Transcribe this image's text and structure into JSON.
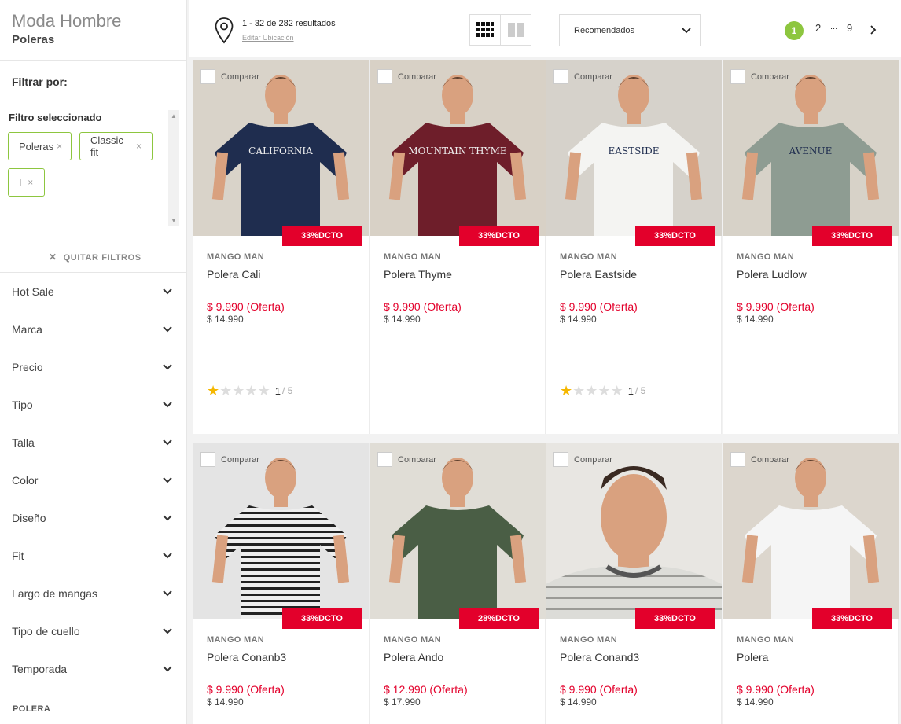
{
  "sidebar": {
    "breadcrumb_parent": "Moda Hombre",
    "breadcrumb_current": "Poleras",
    "filter_by": "Filtrar por:",
    "selected_title": "Filtro seleccionado",
    "chips": [
      {
        "label": "Poleras"
      },
      {
        "label": "Classic fit"
      },
      {
        "label": "L"
      }
    ],
    "clear_filters": "QUITAR FILTROS",
    "facets": [
      {
        "label": "Hot Sale"
      },
      {
        "label": "Marca"
      },
      {
        "label": "Precio"
      },
      {
        "label": "Tipo"
      },
      {
        "label": "Talla"
      },
      {
        "label": "Color"
      },
      {
        "label": "Diseño"
      },
      {
        "label": "Fit"
      },
      {
        "label": "Largo de mangas"
      },
      {
        "label": "Tipo de cuello"
      },
      {
        "label": "Temporada"
      }
    ],
    "footer_label": "POLERA"
  },
  "topbar": {
    "results": "1 - 32 de 282 resultados",
    "edit_location": "Editar Ubicación",
    "sort_selected": "Recomendados",
    "pages": [
      "1",
      "2",
      "...",
      "9"
    ],
    "active_page": "1"
  },
  "colors": {
    "accent_green": "#8dc63f",
    "discount_red": "#e3002b"
  },
  "products": [
    {
      "compare": "Comparar",
      "badge": "33%DCTO",
      "brand": "MANGO MAN",
      "name": "Polera Cali",
      "offer": "$ 9.990 (Oferta)",
      "normal": "$ 14.990",
      "rating": "1",
      "rating_of": "/ 5",
      "shirt": "#1f2d4f",
      "print": "CALIFORNIA"
    },
    {
      "compare": "Comparar",
      "badge": "33%DCTO",
      "brand": "MANGO MAN",
      "name": "Polera Thyme",
      "offer": "$ 9.990 (Oferta)",
      "normal": "$ 14.990",
      "rating": null,
      "rating_of": null,
      "shirt": "#6e1e2a",
      "print": "MOUNTAIN THYME"
    },
    {
      "compare": "Comparar",
      "badge": "33%DCTO",
      "brand": "MANGO MAN",
      "name": "Polera Eastside",
      "offer": "$ 9.990 (Oferta)",
      "normal": "$ 14.990",
      "rating": "1",
      "rating_of": "/ 5",
      "shirt": "#f4f4f2",
      "print": "EASTSIDE"
    },
    {
      "compare": "Comparar",
      "badge": "33%DCTO",
      "brand": "MANGO MAN",
      "name": "Polera Ludlow",
      "offer": "$ 9.990 (Oferta)",
      "normal": "$ 14.990",
      "rating": null,
      "rating_of": null,
      "shirt": "#8e9c92",
      "print": "AVENUE"
    },
    {
      "compare": "Comparar",
      "badge": "33%DCTO",
      "brand": "MANGO MAN",
      "name": "Polera Conanb3",
      "offer": "$ 9.990 (Oferta)",
      "normal": "$ 14.990",
      "rating": null,
      "rating_of": null,
      "shirt": "stripes-dark",
      "print": ""
    },
    {
      "compare": "Comparar",
      "badge": "28%DCTO",
      "brand": "MANGO MAN",
      "name": "Polera Ando",
      "offer": "$ 12.990 (Oferta)",
      "normal": "$ 17.990",
      "rating": null,
      "rating_of": null,
      "shirt": "#4a5e45",
      "print": ""
    },
    {
      "compare": "Comparar",
      "badge": "33%DCTO",
      "brand": "MANGO MAN",
      "name": "Polera Conand3",
      "offer": "$ 9.990 (Oferta)",
      "normal": "$ 14.990",
      "rating": null,
      "rating_of": null,
      "shirt": "stripes-light",
      "print": ""
    },
    {
      "compare": "Comparar",
      "badge": "33%DCTO",
      "brand": "MANGO MAN",
      "name": "Polera",
      "offer": "$ 9.990 (Oferta)",
      "normal": "$ 14.990",
      "rating": null,
      "rating_of": null,
      "shirt": "#f5f5f5",
      "print": ""
    }
  ]
}
